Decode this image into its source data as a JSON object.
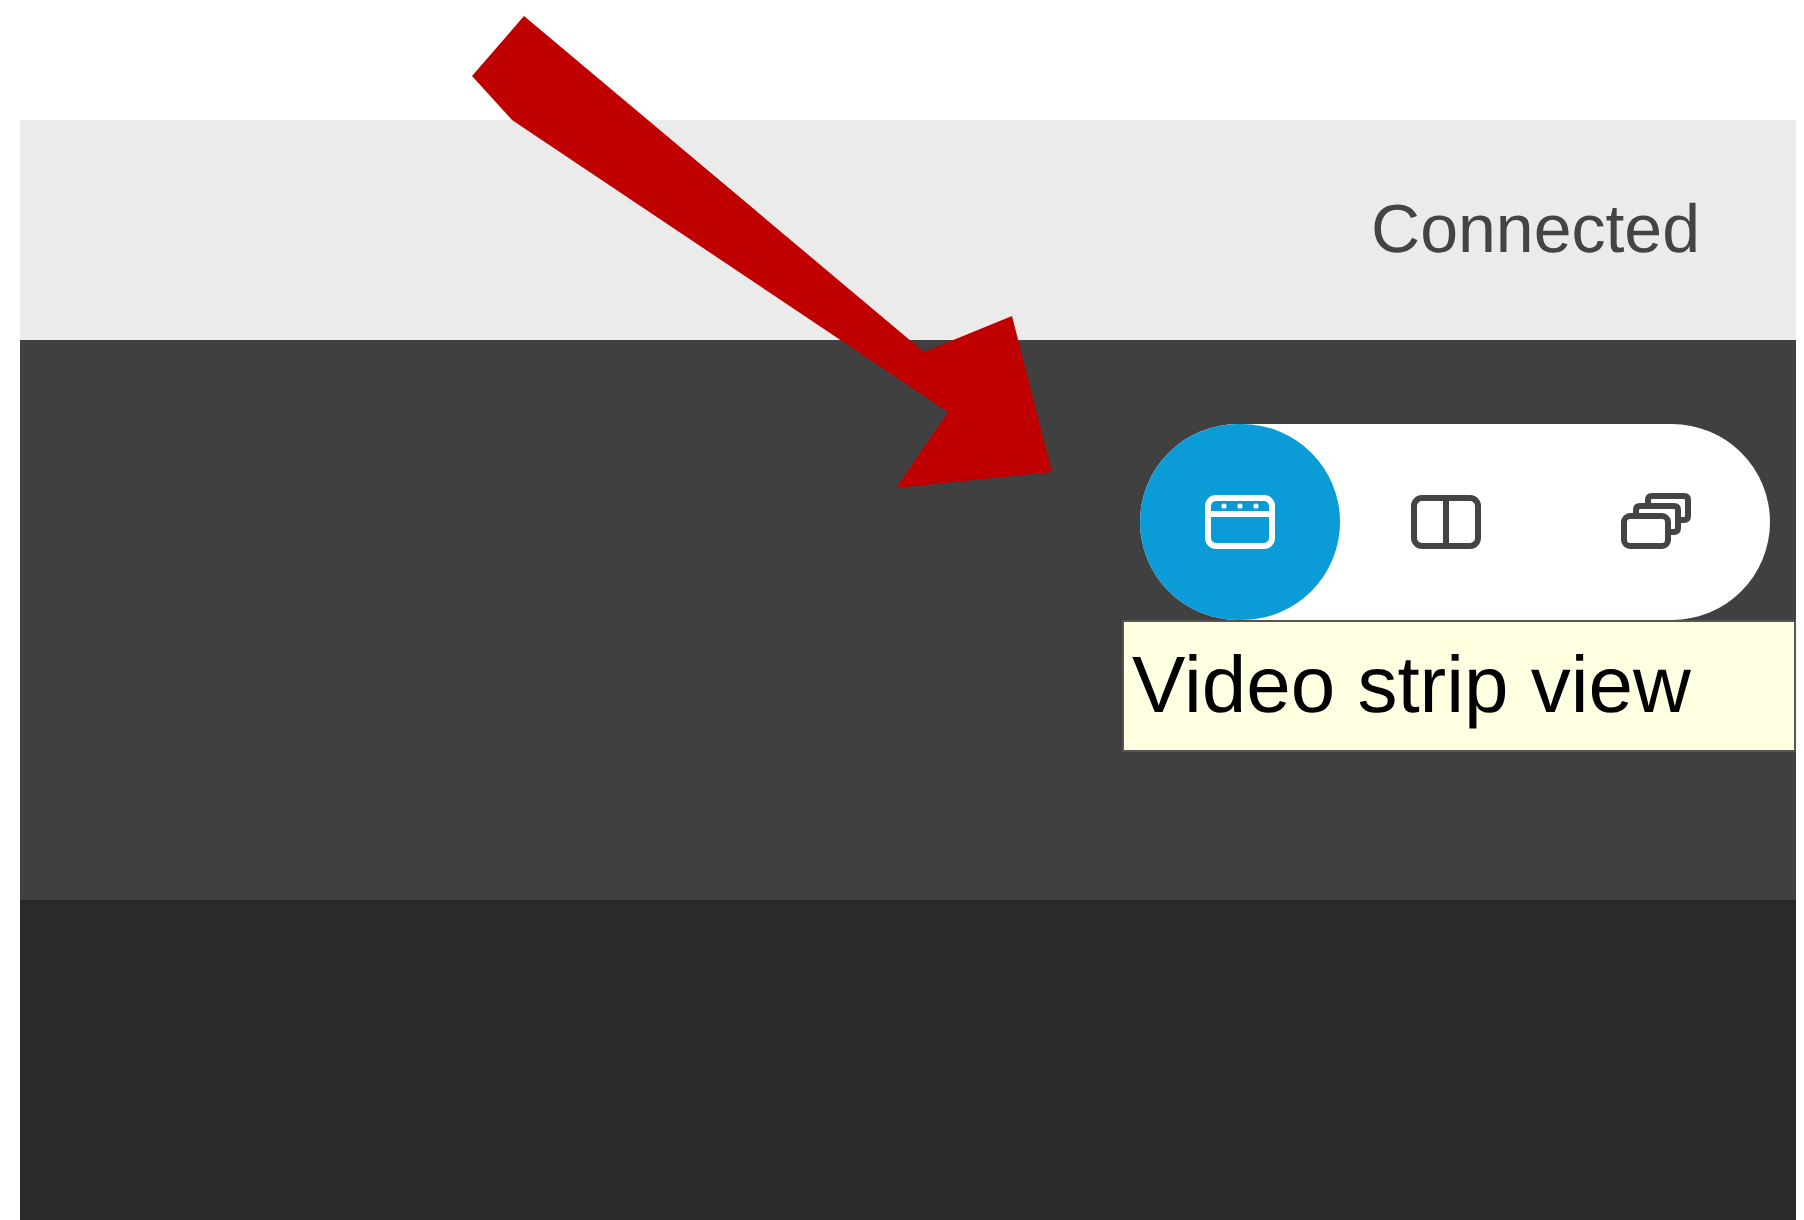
{
  "header": {
    "status": "Connected"
  },
  "view_buttons": [
    {
      "kind": "strip",
      "selected": true
    },
    {
      "kind": "split",
      "selected": false
    },
    {
      "kind": "stacked",
      "selected": false
    }
  ],
  "tooltip": {
    "text": "Video strip view"
  }
}
